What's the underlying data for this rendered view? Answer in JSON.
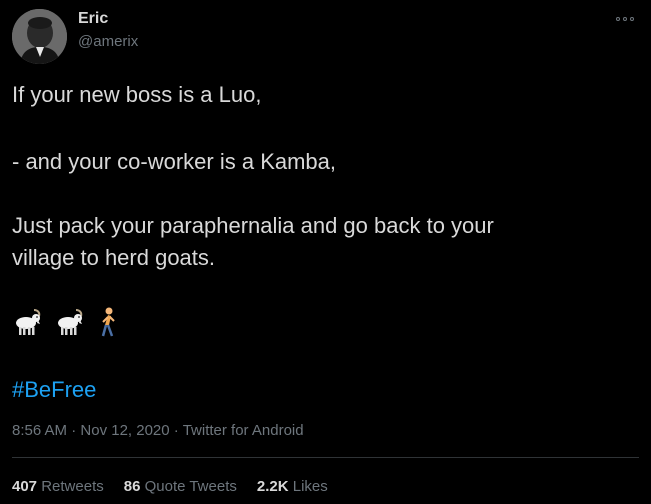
{
  "author": {
    "name": "Eric",
    "handle": "@amerix"
  },
  "tweet": {
    "lines": [
      "If your new boss is a Luo,",
      "- and your co-worker is a Kamba,",
      "Just pack your paraphernalia and go back to your",
      "village to herd goats."
    ],
    "emojis": [
      "goat-icon",
      "goat-icon",
      "person-walking-icon"
    ],
    "hashtag": "#BeFree"
  },
  "meta": {
    "time": "8:56 AM",
    "date": "Nov 12, 2020",
    "separator": "·",
    "source": "Twitter for Android"
  },
  "stats": {
    "retweets": {
      "count": "407",
      "label": "Retweets"
    },
    "quote_tweets": {
      "count": "86",
      "label": "Quote Tweets"
    },
    "likes": {
      "count": "2.2K",
      "label": "Likes"
    }
  },
  "colors": {
    "background": "#000000",
    "text": "#d9d9d9",
    "muted": "#6e767d",
    "accent": "#1da1f2",
    "divider": "#2f3336"
  }
}
